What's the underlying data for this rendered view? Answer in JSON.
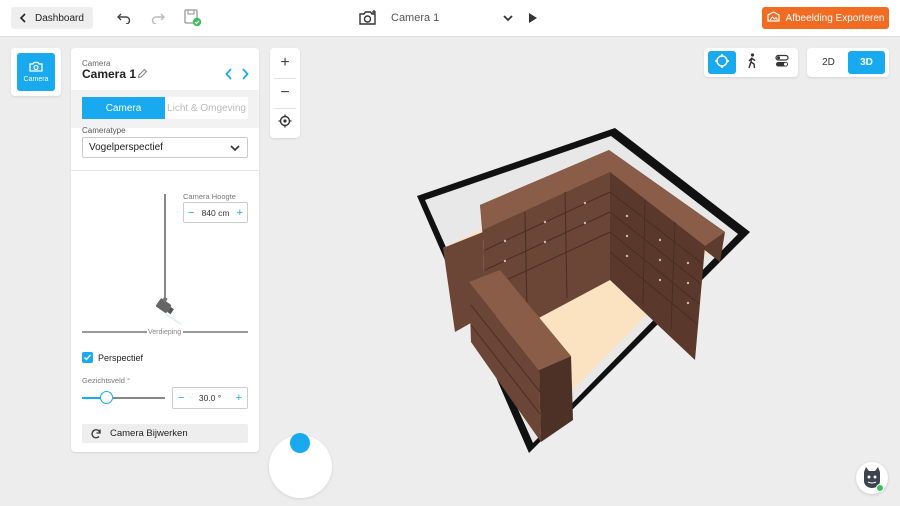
{
  "topbar": {
    "dashboard_label": "Dashboard",
    "camera_title": "Camera 1",
    "export_label": "Afbeelding Exporteren"
  },
  "sidebar": {
    "camera_tile_label": "Camera"
  },
  "panel": {
    "section_label": "Camera",
    "camera_name": "Camera 1",
    "tabs": [
      {
        "label": "Camera",
        "active": true
      },
      {
        "label": "Licht & Omgeving",
        "active": false
      }
    ],
    "camera_type_label": "Cameratype",
    "camera_type_value": "Vogelperspectief",
    "camera_height_label": "Camera Hoogte",
    "camera_height_value": "840 cm",
    "floor_label": "Verdieping",
    "perspective_label": "Perspectief",
    "perspective_checked": true,
    "fov_label": "Gezichtsveld °",
    "fov_value": "30.0 °",
    "fov_slider_fraction": 0.3,
    "update_label": "Camera Bijwerken"
  },
  "zoom": {
    "plus": "+",
    "minus": "−"
  },
  "view_modes": {
    "dim_2d": "2D",
    "dim_3d": "3D",
    "active_dim": "3D",
    "active_mode": "orbit"
  },
  "colors": {
    "accent": "#18a9ef",
    "export": "#f26b22",
    "floor": "#fbe3c2",
    "shelf": "#6b4536"
  }
}
